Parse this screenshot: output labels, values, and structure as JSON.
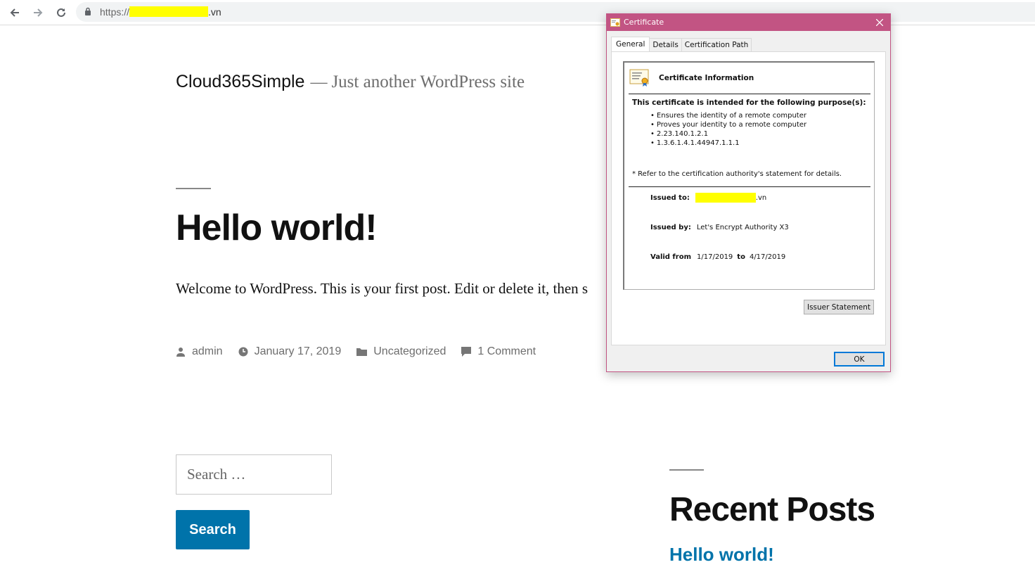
{
  "browser": {
    "url_scheme": "https://",
    "url_suffix": ".vn"
  },
  "site": {
    "title": "Cloud365Simple",
    "separator": "—",
    "tagline": "Just another WordPress site"
  },
  "post": {
    "title": "Hello world!",
    "excerpt": "Welcome to WordPress. This is your first post. Edit or delete it, then s",
    "meta": {
      "author": "admin",
      "date": "January 17, 2019",
      "category": "Uncategorized",
      "comments": "1 Comment"
    }
  },
  "search": {
    "placeholder": "Search …",
    "button_label": "Search"
  },
  "sidebar": {
    "recent_posts_title": "Recent Posts",
    "recent_posts": [
      "Hello world!"
    ]
  },
  "certificate_dialog": {
    "title": "Certificate",
    "tabs": [
      "General",
      "Details",
      "Certification Path"
    ],
    "active_tab": "General",
    "info_heading": "Certificate Information",
    "purpose_heading": "This certificate is intended for the following purpose(s):",
    "purposes": [
      "Ensures the identity of a remote computer",
      "Proves your identity to a remote computer",
      "2.23.140.1.2.1",
      "1.3.6.1.4.1.44947.1.1.1"
    ],
    "refer_note": "* Refer to the certification authority's statement for details.",
    "issued_to_label": "Issued to:",
    "issued_to_suffix": ".vn",
    "issued_by_label": "Issued by:",
    "issued_by": "Let's Encrypt Authority X3",
    "valid_from_label": "Valid from",
    "valid_from": "1/17/2019",
    "to_label": "to",
    "valid_to": "4/17/2019",
    "issuer_statement_label": "Issuer Statement",
    "ok_label": "OK"
  },
  "colors": {
    "link_blue": "#0073aa",
    "dialog_accent": "#c25483",
    "redaction": "#ffff00"
  }
}
